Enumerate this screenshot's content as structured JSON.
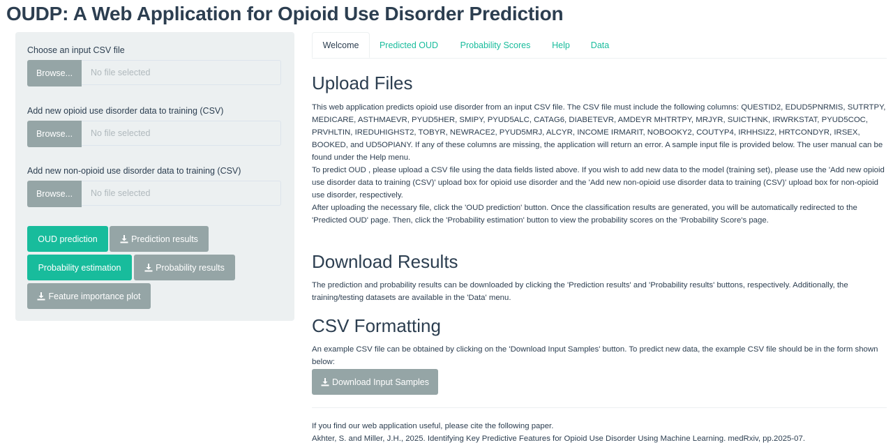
{
  "app": {
    "title": "OUDP: A Web Application for Opioid Use Disorder Prediction"
  },
  "sidebar": {
    "inputs": [
      {
        "label": "Choose an input CSV file",
        "browse": "Browse...",
        "placeholder": "No file selected"
      },
      {
        "label": "Add new opioid use disorder data to training (CSV)",
        "browse": "Browse...",
        "placeholder": "No file selected"
      },
      {
        "label": "Add new non-opioid use disorder data to training (CSV)",
        "browse": "Browse...",
        "placeholder": "No file selected"
      }
    ],
    "buttons": {
      "oud_prediction": "OUD prediction",
      "prediction_results": "Prediction results",
      "probability_estimation": "Probability estimation",
      "probability_results": "Probability results",
      "feature_importance": "Feature importance plot"
    }
  },
  "tabs": [
    "Welcome",
    "Predicted OUD",
    "Probability Scores",
    "Help",
    "Data"
  ],
  "active_tab": "Welcome",
  "colors": {
    "primary": "#2c3e50",
    "success": "#18bc9c",
    "default": "#95a5a6",
    "panel": "#ecf0f1"
  },
  "main": {
    "upload": {
      "heading": "Upload Files",
      "p1": "This web application predicts opioid use disorder from an input CSV file. The CSV file must include the following columns: QUESTID2, EDUD5PNRMIS, SUTRTPY, MEDICARE, ASTHMAEVR, PYUD5HER, SMIPY, PYUD5ALC, CATAG6, DIABETEVR, AMDEYR MHTRTPY, MRJYR, SUICTHNK, IRWRKSTAT, PYUD5COC, PRVHLTIN, IREDUHIGHST2, TOBYR, NEWRACE2, PYUD5MRJ, ALCYR, INCOME IRMARIT, NOBOOKY2, COUTYP4, IRHHSIZ2, HRTCONDYR, IRSEX, BOOKED, and UD5OPIANY. If any of these columns are missing, the application will return an error. A sample input file is provided below. The user manual can be found under the Help menu.",
      "p2": "To predict OUD , please upload a CSV file using the data fields listed above. If you wish to add new data to the model (training set), please use the 'Add new opioid use disorder data to training (CSV)' upload box for opioid use disorder and the 'Add new non-opioid use disorder data to training (CSV)' upload box for non-opioid use disorder, respectively.",
      "p3": "After uploading the necessary file, click the 'OUD prediction' button. Once the classification results are generated, you will be automatically redirected to the 'Predicted OUD' page. Then, click the 'Probability estimation' button to view the probability scores on the 'Probability Score's page."
    },
    "download": {
      "heading": "Download Results",
      "p1": "The prediction and probability results can be downloaded by clicking the 'Prediction results' and 'Probability results' buttons, respectively. Additionally, the training/testing datasets are available in the 'Data' menu."
    },
    "csv": {
      "heading": "CSV Formatting",
      "p1": "An example CSV file can be obtained by clicking on the 'Download Input Samples' button. To predict new data, the example CSV file should be in the form shown below:",
      "button": "Download Input Samples"
    },
    "citation": {
      "intro": "If you find our web application useful, please cite the following paper.",
      "ref": "Akhter, S. and Miller, J.H., 2025. Identifying Key Predictive Features for Opioid Use Disorder Using Machine Learning. medRxiv, pp.2025-07."
    }
  }
}
